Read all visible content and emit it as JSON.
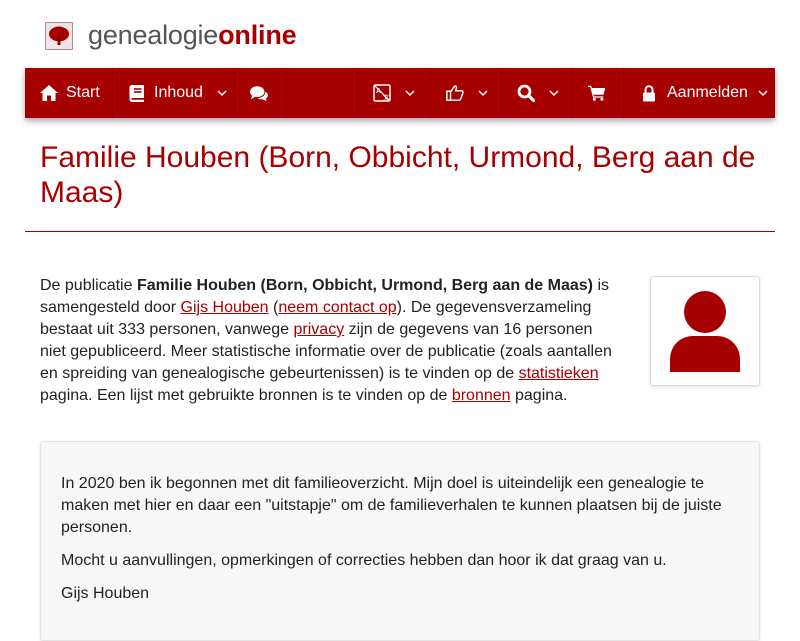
{
  "site": {
    "logo_text_plain": "genealogie",
    "logo_text_accent": "online"
  },
  "nav": {
    "start_label": "Start",
    "inhoud_label": "Inhoud",
    "login_label": "Aanmelden"
  },
  "page": {
    "title": "Familie Houben (Born, Obbicht, Urmond, Berg aan de Maas)"
  },
  "intro": {
    "t1": "De publicatie ",
    "pub_name": "Familie Houben (Born, Obbicht, Urmond, Berg aan de Maas)",
    "t2": " is samengesteld door ",
    "author_link": "Gijs Houben",
    "t3": " (",
    "contact_link": "neem contact op",
    "t4": "). De gegevensverzameling bestaat uit 333 personen, vanwege ",
    "privacy_link": "privacy",
    "t5": " zijn de gegevens van 16 personen niet gepubliceerd. Meer statistische informatie over de publicatie (zoals aantallen en spreiding van genealogische gebeurtenissen) is te vinden op de ",
    "stats_link": "statistieken",
    "t6": " pagina. Een lijst met gebruikte bronnen is te vinden op de ",
    "sources_link": "bronnen",
    "t7": " pagina."
  },
  "note": {
    "p1": "In 2020 ben ik begonnen met dit familieoverzicht. Mijn doel is uiteindelijk een genealogie te maken met hier en daar een \"uitstapje\" om de familieverhalen te kunnen plaatsen bij de juiste personen.",
    "p2": "Mocht u aanvullingen, opmerkingen of correcties hebben dan hoor ik dat graag van u.",
    "p3": "Gijs Houben"
  },
  "icons": {
    "logo": "tree-icon",
    "start": "home-icon",
    "inhoud": "book-icon",
    "chat": "comments-icon",
    "language": "translate-icon",
    "like": "thumbs-up-icon",
    "search": "search-icon",
    "cart": "shopping-cart-icon",
    "login": "lock-icon",
    "avatar": "user-icon"
  },
  "colors": {
    "brand": "#a70000",
    "text": "#222222",
    "note_bg": "#f7f7f7"
  }
}
